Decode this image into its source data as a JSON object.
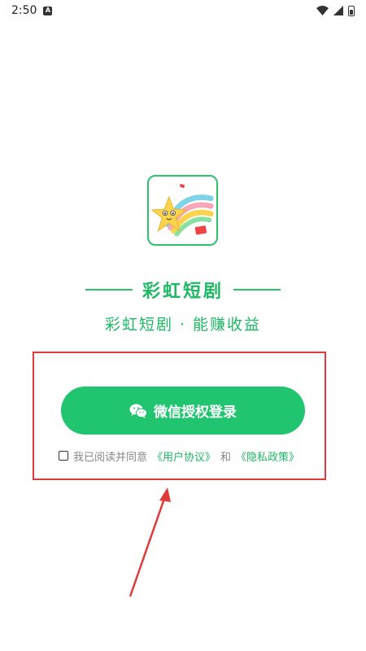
{
  "status_bar": {
    "time": "2:50",
    "notification_icon": "A"
  },
  "app": {
    "title": "彩虹短剧",
    "slogan": "彩虹短剧 · 能赚收益"
  },
  "login": {
    "wechat_button_label": "微信授权登录"
  },
  "agreement": {
    "prefix": "我已阅读并同意",
    "user_agreement": "《用户协议》",
    "conjunction": "和",
    "privacy_policy": "《隐私政策》"
  },
  "colors": {
    "accent": "#21c46f",
    "highlight": "#e03a3a"
  }
}
